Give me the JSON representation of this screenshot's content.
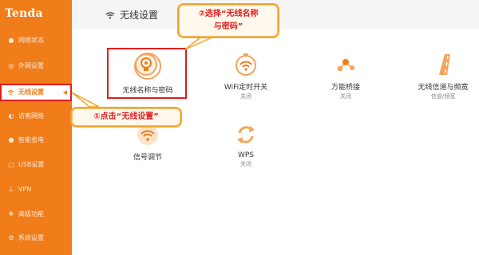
{
  "brand": {
    "logo_text": "Tenda",
    "accent": "#f07d1a",
    "highlight": "#e11d1d"
  },
  "sidebar": {
    "items": [
      {
        "label": "网络状态",
        "icon": "user-icon",
        "active": false
      },
      {
        "label": "外网设置",
        "icon": "globe-icon",
        "active": false
      },
      {
        "label": "无线设置",
        "icon": "wifi-icon",
        "active": true
      },
      {
        "label": "访客网络",
        "icon": "guest-icon",
        "active": false
      },
      {
        "label": "智能省电",
        "icon": "bulb-icon",
        "active": false
      },
      {
        "label": "USB设置",
        "icon": "usb-icon",
        "active": false
      },
      {
        "label": "VPN",
        "icon": "vpn-icon",
        "active": false
      },
      {
        "label": "高级功能",
        "icon": "tools-icon",
        "active": false
      },
      {
        "label": "系统设置",
        "icon": "gear-icon",
        "active": false
      }
    ]
  },
  "header": {
    "title": "无线设置",
    "icon": "wifi-icon"
  },
  "tiles": [
    {
      "label": "无线名称与密码",
      "sub": "",
      "icon": "wifi-lock-icon"
    },
    {
      "label": "WiFi定时开关",
      "sub": "关闭",
      "icon": "wifi-timer-icon"
    },
    {
      "label": "万能桥接",
      "sub": "关闭",
      "icon": "bridge-icon"
    },
    {
      "label": "无线信道与频宽",
      "sub": "信道/频宽",
      "icon": "road-icon"
    },
    {
      "label": "信号调节",
      "sub": "",
      "icon": "signal-icon"
    },
    {
      "label": "WPS",
      "sub": "关闭",
      "icon": "wps-icon"
    }
  ],
  "callouts": {
    "step1": "①点击“无线设置”",
    "step2_line1": "②选择“无线名称",
    "step2_line2": "与密码”"
  }
}
